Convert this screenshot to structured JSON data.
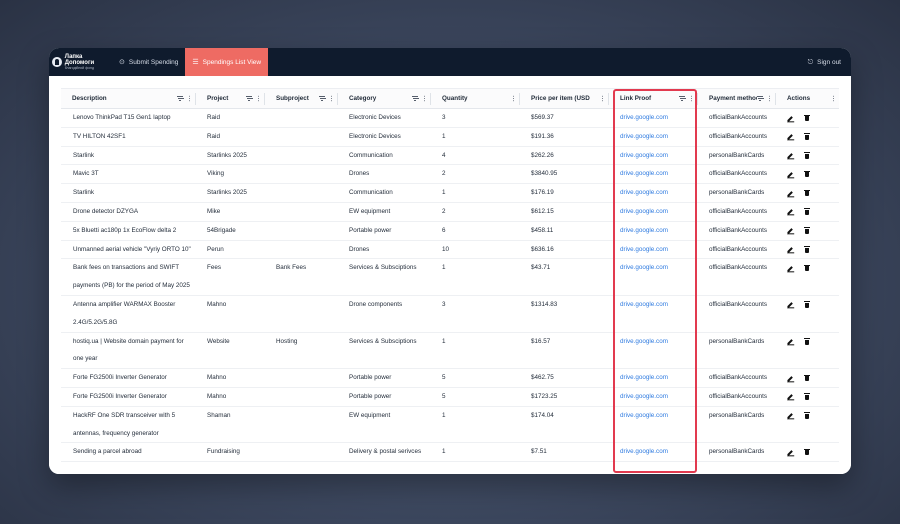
{
  "brand": {
    "name": "Лапка Допомоги",
    "subtitle": "благодійний фонд"
  },
  "nav": {
    "items": [
      {
        "label": "Submit Spending",
        "icon": "dollar-circle-icon",
        "active": false
      },
      {
        "label": "Spendings List View",
        "icon": "list-icon",
        "active": true
      }
    ],
    "signout_label": "Sign out"
  },
  "table": {
    "columns": [
      {
        "key": "description",
        "label": "Description"
      },
      {
        "key": "project",
        "label": "Project"
      },
      {
        "key": "subproject",
        "label": "Subproject"
      },
      {
        "key": "category",
        "label": "Category"
      },
      {
        "key": "quantity",
        "label": "Quantity"
      },
      {
        "key": "price",
        "label": "Price per item (USD"
      },
      {
        "key": "link",
        "label": "Link Proof"
      },
      {
        "key": "payment",
        "label": "Payment method"
      },
      {
        "key": "actions",
        "label": "Actions"
      }
    ],
    "rows": [
      {
        "description": "Lenovo ThinkPad T15 Gen1 laptop",
        "project": "Raid",
        "subproject": "",
        "category": "Electronic Devices",
        "quantity": "3",
        "price": "$569.37",
        "link": "drive.google.com",
        "payment": "officialBankAccounts"
      },
      {
        "description": "TV HILTON 42SF1",
        "project": "Raid",
        "subproject": "",
        "category": "Electronic Devices",
        "quantity": "1",
        "price": "$191.36",
        "link": "drive.google.com",
        "payment": "officialBankAccounts"
      },
      {
        "description": "Starlink",
        "project": "Starlinks 2025",
        "subproject": "",
        "category": "Communication",
        "quantity": "4",
        "price": "$262.26",
        "link": "drive.google.com",
        "payment": "personalBankCards"
      },
      {
        "description": "Mavic 3T",
        "project": "Viking",
        "subproject": "",
        "category": "Drones",
        "quantity": "2",
        "price": "$3840.95",
        "link": "drive.google.com",
        "payment": "officialBankAccounts"
      },
      {
        "description": "Starlink",
        "project": "Starlinks 2025",
        "subproject": "",
        "category": "Communication",
        "quantity": "1",
        "price": "$176.19",
        "link": "drive.google.com",
        "payment": "personalBankCards"
      },
      {
        "description": "Drone detector DZYGA",
        "project": "Mike",
        "subproject": "",
        "category": "EW equipment",
        "quantity": "2",
        "price": "$612.15",
        "link": "drive.google.com",
        "payment": "officialBankAccounts"
      },
      {
        "description": "5x Bluetti ac180p 1x EcoFlow delta 2",
        "project": "54Brigade",
        "subproject": "",
        "category": "Portable power",
        "quantity": "6",
        "price": "$458.11",
        "link": "drive.google.com",
        "payment": "officialBankAccounts"
      },
      {
        "description": "Unmanned aerial vehicle \"Vyriy ORTO 10\"",
        "project": "Perun",
        "subproject": "",
        "category": "Drones",
        "quantity": "10",
        "price": "$636.16",
        "link": "drive.google.com",
        "payment": "officialBankAccounts"
      },
      {
        "description": "Bank fees on transactions and SWIFT payments (PB) for the period of May 2025",
        "project": "Fees",
        "subproject": "Bank Fees",
        "category": "Services & Subsciptions",
        "quantity": "1",
        "price": "$43.71",
        "link": "drive.google.com",
        "payment": "officialBankAccounts"
      },
      {
        "description": "Antenna amplifier WARMAX Booster 2.4G/5.2G/5.8G",
        "project": "Mahno",
        "subproject": "",
        "category": "Drone components",
        "quantity": "3",
        "price": "$1314.83",
        "link": "drive.google.com",
        "payment": "officialBankAccounts"
      },
      {
        "description": "hostiq.ua | Website domain payment for one year",
        "project": "Website",
        "subproject": "Hosting",
        "category": "Services & Subsciptions",
        "quantity": "1",
        "price": "$16.57",
        "link": "drive.google.com",
        "payment": "personalBankCards"
      },
      {
        "description": "Forte FG2500i Inverter Generator",
        "project": "Mahno",
        "subproject": "",
        "category": "Portable power",
        "quantity": "5",
        "price": "$462.75",
        "link": "drive.google.com",
        "payment": "officialBankAccounts"
      },
      {
        "description": "Forte FG2500i Inverter Generator",
        "project": "Mahno",
        "subproject": "",
        "category": "Portable power",
        "quantity": "5",
        "price": "$1723.25",
        "link": "drive.google.com",
        "payment": "officialBankAccounts"
      },
      {
        "description": "HackRF One SDR transceiver with 5 antennas, frequency generator",
        "project": "Shaman",
        "subproject": "",
        "category": "EW equipment",
        "quantity": "1",
        "price": "$174.04",
        "link": "drive.google.com",
        "payment": "personalBankCards"
      },
      {
        "description": "Sending a parcel abroad",
        "project": "Fundraising",
        "subproject": "",
        "category": "Delivery & postal serivces",
        "quantity": "1",
        "price": "$7.51",
        "link": "drive.google.com",
        "payment": "personalBankCards"
      }
    ]
  },
  "colors": {
    "nav_bg": "#0f1b2d",
    "active_tab": "#ee6b63",
    "link": "#2f7be0",
    "highlight": "#e23a4f"
  }
}
